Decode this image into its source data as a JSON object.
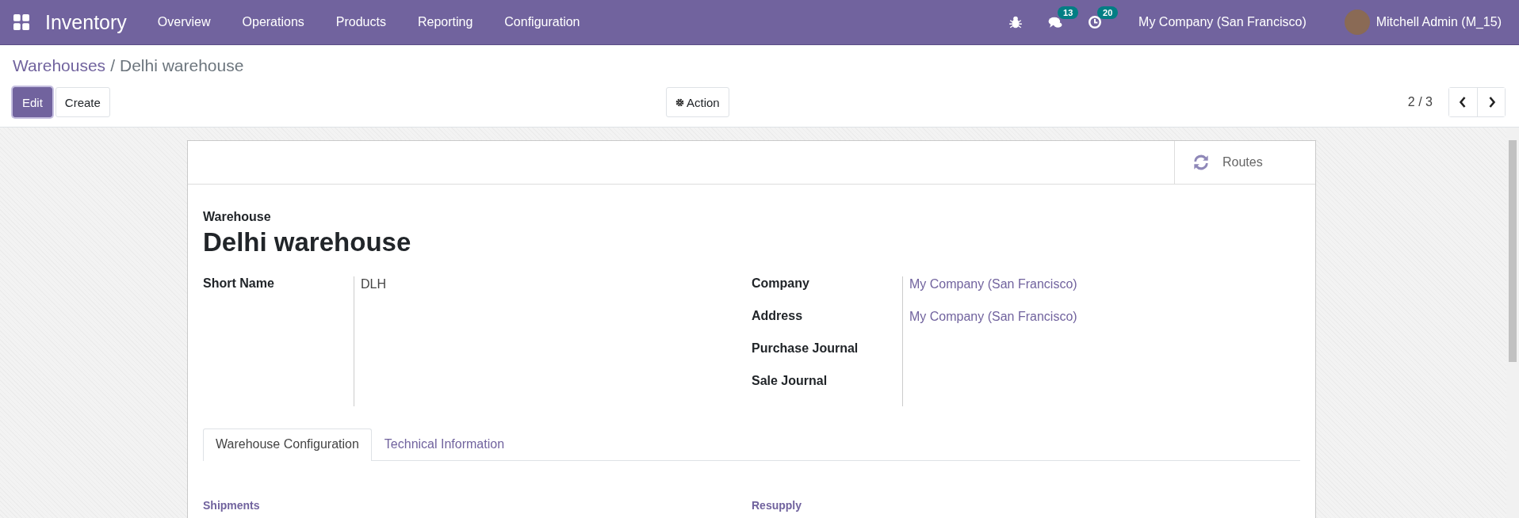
{
  "navbar": {
    "app_name": "Inventory",
    "menu": [
      "Overview",
      "Operations",
      "Products",
      "Reporting",
      "Configuration"
    ],
    "systray": [
      {
        "kind": "bug"
      },
      {
        "kind": "chat",
        "badge": "13"
      },
      {
        "kind": "clock",
        "badge": "20"
      }
    ],
    "company": "My Company (San Francisco)",
    "user": "Mitchell Admin (M_15)"
  },
  "breadcrumb": {
    "parent": "Warehouses",
    "separator": "/",
    "current": "Delhi warehouse"
  },
  "buttons": [
    {
      "label": "Edit",
      "primary": true
    },
    {
      "label": "Create",
      "primary": false
    }
  ],
  "action": "Action",
  "pager": "2 / 3",
  "button_box": [
    {
      "label": "Routes"
    }
  ],
  "form": {
    "caption": "Warehouse",
    "title": "Delhi warehouse",
    "left_fields": [
      {
        "label": "Short Name",
        "value": "DLH",
        "link": false
      }
    ],
    "right_fields": [
      {
        "label": "Company",
        "value": "My Company (San Francisco)",
        "link": true
      },
      {
        "label": "Address",
        "value": "My Company (San Francisco)",
        "link": true
      },
      {
        "label": "Purchase Journal"
      },
      {
        "label": "Sale Journal"
      }
    ],
    "tabs": [
      {
        "label": "Warehouse Configuration",
        "selected": true
      },
      {
        "label": "Technical Information",
        "selected": false
      }
    ],
    "sections": [
      "Shipments",
      "Resupply"
    ]
  }
}
